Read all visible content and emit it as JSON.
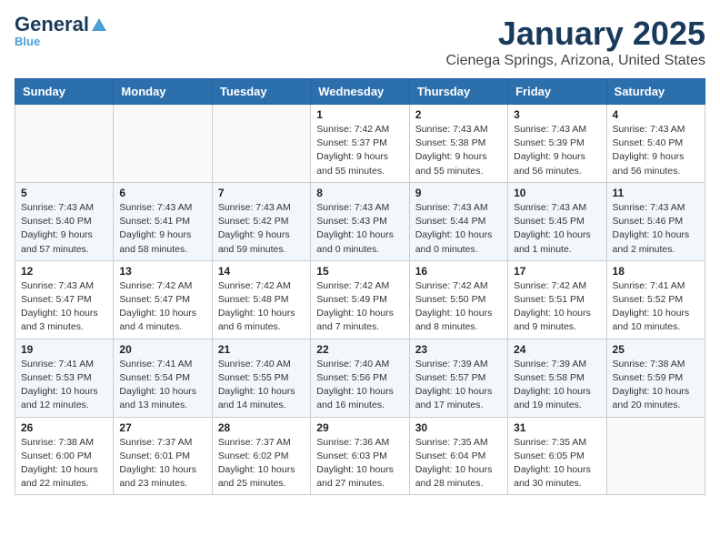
{
  "header": {
    "logo_general": "General",
    "logo_blue": "Blue",
    "month_title": "January 2025",
    "location": "Cienega Springs, Arizona, United States"
  },
  "days_of_week": [
    "Sunday",
    "Monday",
    "Tuesday",
    "Wednesday",
    "Thursday",
    "Friday",
    "Saturday"
  ],
  "weeks": [
    [
      {
        "day": "",
        "content": ""
      },
      {
        "day": "",
        "content": ""
      },
      {
        "day": "",
        "content": ""
      },
      {
        "day": "1",
        "content": "Sunrise: 7:42 AM\nSunset: 5:37 PM\nDaylight: 9 hours and 55 minutes."
      },
      {
        "day": "2",
        "content": "Sunrise: 7:43 AM\nSunset: 5:38 PM\nDaylight: 9 hours and 55 minutes."
      },
      {
        "day": "3",
        "content": "Sunrise: 7:43 AM\nSunset: 5:39 PM\nDaylight: 9 hours and 56 minutes."
      },
      {
        "day": "4",
        "content": "Sunrise: 7:43 AM\nSunset: 5:40 PM\nDaylight: 9 hours and 56 minutes."
      }
    ],
    [
      {
        "day": "5",
        "content": "Sunrise: 7:43 AM\nSunset: 5:40 PM\nDaylight: 9 hours and 57 minutes."
      },
      {
        "day": "6",
        "content": "Sunrise: 7:43 AM\nSunset: 5:41 PM\nDaylight: 9 hours and 58 minutes."
      },
      {
        "day": "7",
        "content": "Sunrise: 7:43 AM\nSunset: 5:42 PM\nDaylight: 9 hours and 59 minutes."
      },
      {
        "day": "8",
        "content": "Sunrise: 7:43 AM\nSunset: 5:43 PM\nDaylight: 10 hours and 0 minutes."
      },
      {
        "day": "9",
        "content": "Sunrise: 7:43 AM\nSunset: 5:44 PM\nDaylight: 10 hours and 0 minutes."
      },
      {
        "day": "10",
        "content": "Sunrise: 7:43 AM\nSunset: 5:45 PM\nDaylight: 10 hours and 1 minute."
      },
      {
        "day": "11",
        "content": "Sunrise: 7:43 AM\nSunset: 5:46 PM\nDaylight: 10 hours and 2 minutes."
      }
    ],
    [
      {
        "day": "12",
        "content": "Sunrise: 7:43 AM\nSunset: 5:47 PM\nDaylight: 10 hours and 3 minutes."
      },
      {
        "day": "13",
        "content": "Sunrise: 7:42 AM\nSunset: 5:47 PM\nDaylight: 10 hours and 4 minutes."
      },
      {
        "day": "14",
        "content": "Sunrise: 7:42 AM\nSunset: 5:48 PM\nDaylight: 10 hours and 6 minutes."
      },
      {
        "day": "15",
        "content": "Sunrise: 7:42 AM\nSunset: 5:49 PM\nDaylight: 10 hours and 7 minutes."
      },
      {
        "day": "16",
        "content": "Sunrise: 7:42 AM\nSunset: 5:50 PM\nDaylight: 10 hours and 8 minutes."
      },
      {
        "day": "17",
        "content": "Sunrise: 7:42 AM\nSunset: 5:51 PM\nDaylight: 10 hours and 9 minutes."
      },
      {
        "day": "18",
        "content": "Sunrise: 7:41 AM\nSunset: 5:52 PM\nDaylight: 10 hours and 10 minutes."
      }
    ],
    [
      {
        "day": "19",
        "content": "Sunrise: 7:41 AM\nSunset: 5:53 PM\nDaylight: 10 hours and 12 minutes."
      },
      {
        "day": "20",
        "content": "Sunrise: 7:41 AM\nSunset: 5:54 PM\nDaylight: 10 hours and 13 minutes."
      },
      {
        "day": "21",
        "content": "Sunrise: 7:40 AM\nSunset: 5:55 PM\nDaylight: 10 hours and 14 minutes."
      },
      {
        "day": "22",
        "content": "Sunrise: 7:40 AM\nSunset: 5:56 PM\nDaylight: 10 hours and 16 minutes."
      },
      {
        "day": "23",
        "content": "Sunrise: 7:39 AM\nSunset: 5:57 PM\nDaylight: 10 hours and 17 minutes."
      },
      {
        "day": "24",
        "content": "Sunrise: 7:39 AM\nSunset: 5:58 PM\nDaylight: 10 hours and 19 minutes."
      },
      {
        "day": "25",
        "content": "Sunrise: 7:38 AM\nSunset: 5:59 PM\nDaylight: 10 hours and 20 minutes."
      }
    ],
    [
      {
        "day": "26",
        "content": "Sunrise: 7:38 AM\nSunset: 6:00 PM\nDaylight: 10 hours and 22 minutes."
      },
      {
        "day": "27",
        "content": "Sunrise: 7:37 AM\nSunset: 6:01 PM\nDaylight: 10 hours and 23 minutes."
      },
      {
        "day": "28",
        "content": "Sunrise: 7:37 AM\nSunset: 6:02 PM\nDaylight: 10 hours and 25 minutes."
      },
      {
        "day": "29",
        "content": "Sunrise: 7:36 AM\nSunset: 6:03 PM\nDaylight: 10 hours and 27 minutes."
      },
      {
        "day": "30",
        "content": "Sunrise: 7:35 AM\nSunset: 6:04 PM\nDaylight: 10 hours and 28 minutes."
      },
      {
        "day": "31",
        "content": "Sunrise: 7:35 AM\nSunset: 6:05 PM\nDaylight: 10 hours and 30 minutes."
      },
      {
        "day": "",
        "content": ""
      }
    ]
  ]
}
